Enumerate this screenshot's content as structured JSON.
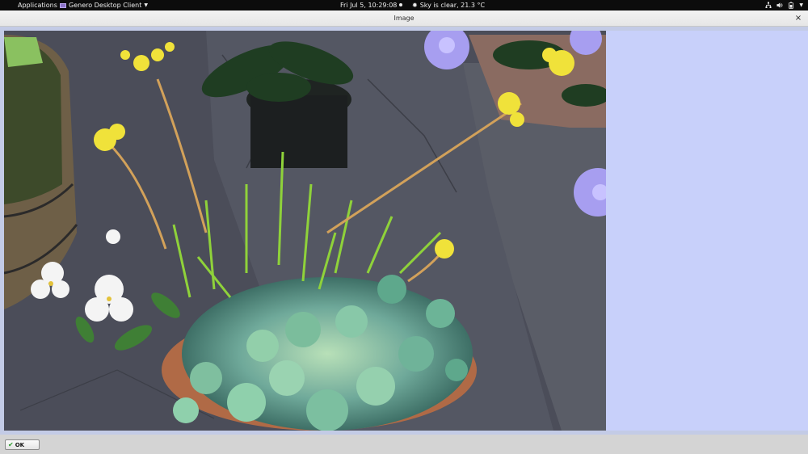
{
  "topbar": {
    "applications_label": "Applications",
    "app_menu_label": "Genero Desktop Client",
    "clock": "Fri Jul  5, 10:29:08",
    "weather": "Sky is clear, 21.3 °C",
    "tray_icons": [
      "network-icon",
      "volume-icon",
      "battery-icon",
      "chevron-down-icon"
    ]
  },
  "window": {
    "title": "Image",
    "close_glyph": "×"
  },
  "image": {
    "subject": "potted succulents, yellow-flowered sedum, white and purple flowers on stone paving"
  },
  "buttons": {
    "ok_label": "OK"
  },
  "colors": {
    "topbar_bg": "#0c0c0c",
    "content_bg": "#c8d0fa",
    "ok_check": "#2a9a2a"
  }
}
